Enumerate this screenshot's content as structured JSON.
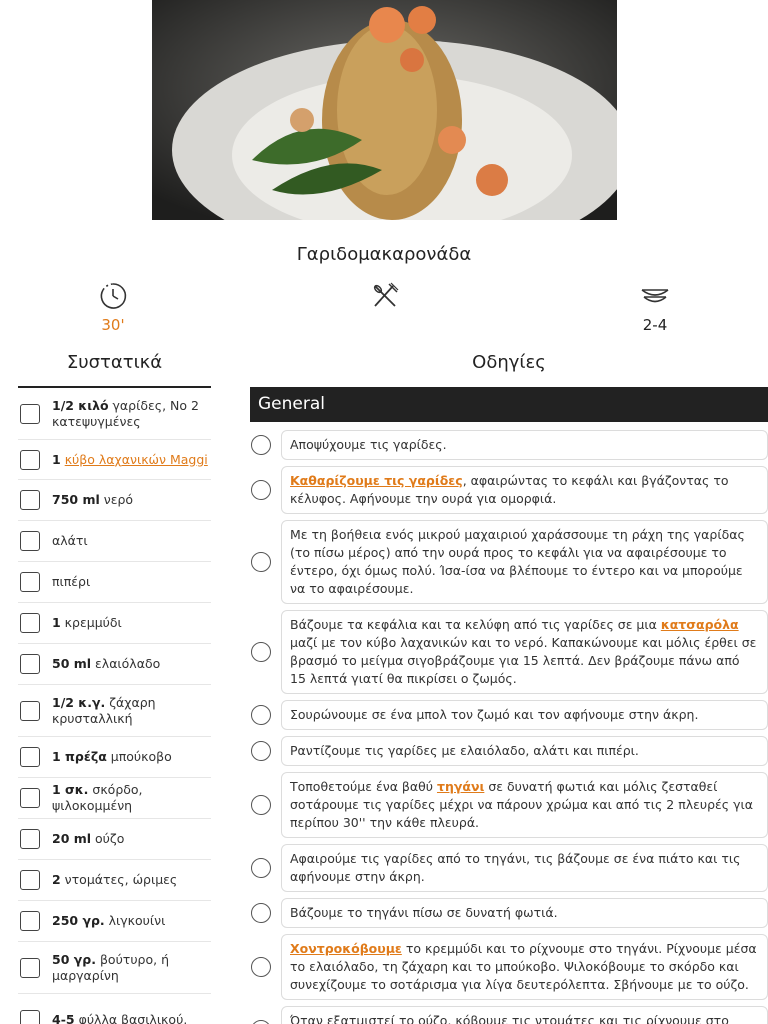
{
  "recipe": {
    "title": "Γαριδομακαρονάδα",
    "time": "30'",
    "servings": "2-4"
  },
  "icons": {
    "time": "timer-icon",
    "difficulty": "utensils-icon",
    "servings": "bowls-icon"
  },
  "headings": {
    "ingredients": "Συστατικά",
    "instructions": "Οδηγίες",
    "section": "General"
  },
  "colors": {
    "accent": "#e07b1a",
    "section_bar": "#222222"
  },
  "ingredients": [
    {
      "qty": "1/2 κιλό",
      "text": " γαρίδες, Νο 2 κατεψυγμένες"
    },
    {
      "qty": "1",
      "text": "",
      "link": "κύβο λαχανικών Maggi"
    },
    {
      "qty": "750 ml",
      "text": " νερό"
    },
    {
      "qty": "",
      "text": "αλάτι"
    },
    {
      "qty": "",
      "text": "πιπέρι"
    },
    {
      "qty": "1",
      "text": " κρεμμύδι"
    },
    {
      "qty": "50 ml",
      "text": " ελαιόλαδο"
    },
    {
      "qty": "1/2 κ.γ.",
      "text": " ζάχαρη κρυσταλλική"
    },
    {
      "qty": "1 πρέζα",
      "text": " μπούκοβο"
    },
    {
      "qty": "1 σκ.",
      "text": " σκόρδο, ψιλοκομμένη"
    },
    {
      "qty": "20 ml",
      "text": " ούζο"
    },
    {
      "qty": "2",
      "text": " ντομάτες, ώριμες"
    },
    {
      "qty": "250 γρ.",
      "text": " λιγκουίνι"
    },
    {
      "qty": "50 γρ.",
      "text": " βούτυρο, ή μαργαρίνη"
    },
    {
      "qty": "4-5",
      "text": " φύλλα βασιλικού,"
    }
  ],
  "steps": [
    {
      "lead": "",
      "text": "Αποψύχουμε τις γαρίδες."
    },
    {
      "lead": "Καθαρίζουμε τις γαρίδες",
      "text": ", αφαιρώντας το κεφάλι και βγάζοντας το κέλυφος. Αφήνουμε την ουρά για ομορφιά."
    },
    {
      "lead": "",
      "text": "Με τη βοήθεια ενός μικρού μαχαιριού χαράσσουμε τη ράχη της γαρίδας (το πίσω μέρος) από την ουρά προς το κεφάλι για να αφαιρέσουμε το έντερο, όχι όμως πολύ. Ίσα-ίσα να βλέπουμε το έντερο και να μπορούμε να το αφαιρέσουμε."
    },
    {
      "pre": "Βάζουμε τα κεφάλια και τα κελύφη από τις γαρίδες σε μια ",
      "mid": "κατσαρόλα",
      "post": " μαζί με τον κύβο λαχανικών και το νερό. Καπακώνουμε και μόλις έρθει σε βρασμό το μείγμα σιγοβράζουμε για 15 λεπτά. Δεν βράζουμε πάνω από 15 λεπτά γιατί θα πικρίσει ο ζωμός."
    },
    {
      "lead": "",
      "text": "Σουρώνουμε σε ένα μπολ τον ζωμό και τον αφήνουμε στην άκρη."
    },
    {
      "lead": "",
      "text": "Ραντίζουμε τις γαρίδες με ελαιόλαδο, αλάτι και πιπέρι."
    },
    {
      "pre": "Τοποθετούμε ένα βαθύ ",
      "mid": "τηγάνι",
      "post": " σε δυνατή φωτιά και μόλις ζεσταθεί σοτάρουμε τις γαρίδες μέχρι να πάρουν χρώμα και από τις 2 πλευρές για περίπου 30'' την κάθε πλευρά."
    },
    {
      "lead": "",
      "text": "Αφαιρούμε τις γαρίδες από το τηγάνι, τις βάζουμε σε ένα πιάτο και τις αφήνουμε στην άκρη."
    },
    {
      "lead": "",
      "text": "Βάζουμε το τηγάνι πίσω σε δυνατή φωτιά."
    },
    {
      "lead": "Χοντροκόβουμε",
      "text": " το κρεμμύδι και το ρίχνουμε στο τηγάνι. Ρίχνουμε μέσα το ελαιόλαδο, τη ζάχαρη και το μπούκοβο. Ψιλοκόβουμε το σκόρδο και συνεχίζουμε το σοτάρισμα για λίγα δευτερόλεπτα. Σβήνουμε με το ούζο."
    },
    {
      "lead": "",
      "text": "Όταν εξατμιστεί το ούζο, κόβουμε τις ντομάτες και τις ρίχνουμε στο τηγάνι."
    }
  ]
}
